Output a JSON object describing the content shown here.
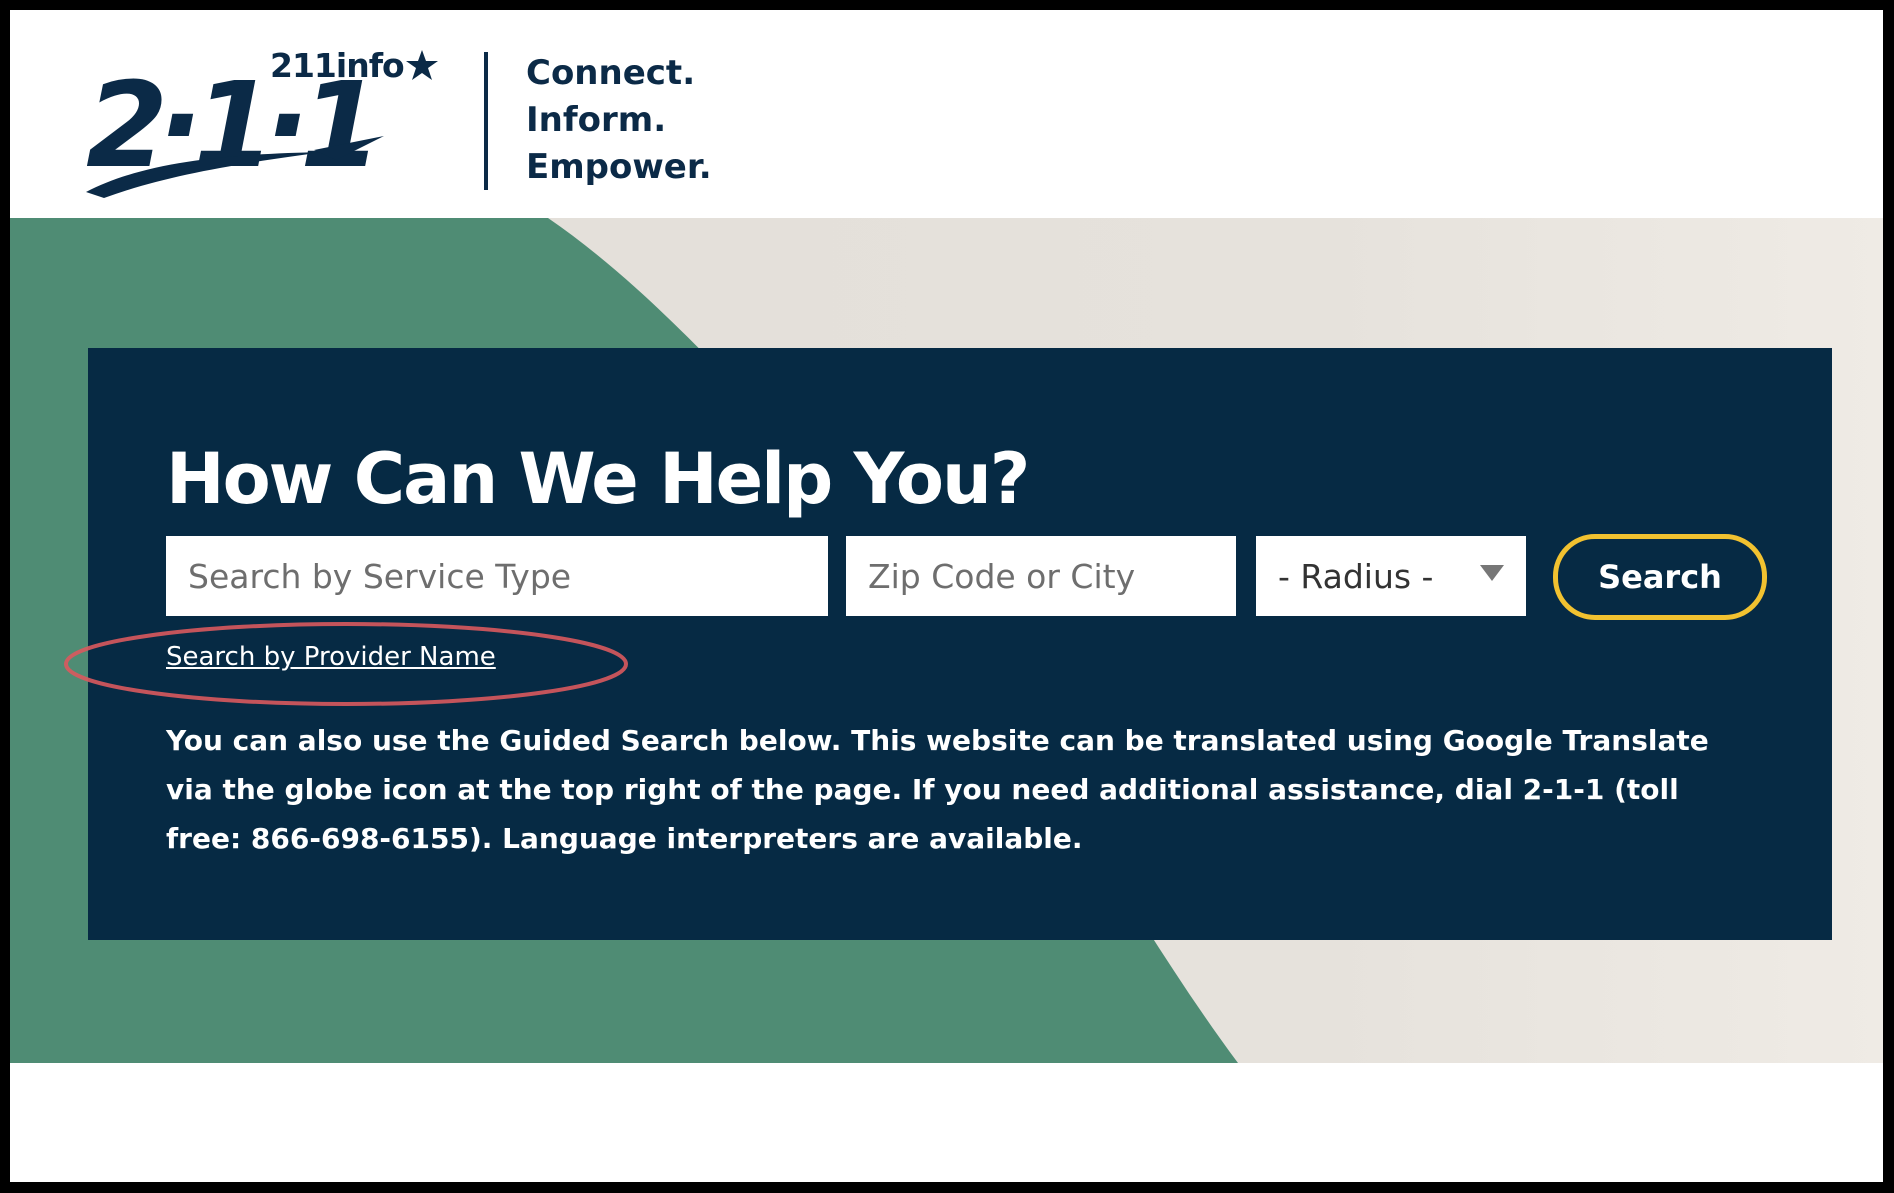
{
  "header": {
    "logo_small": "211info",
    "logo_main": "2·1·1",
    "tagline": [
      "Connect.",
      "Inform.",
      "Empower."
    ]
  },
  "hero": {
    "title": "How Can We Help You?",
    "service_placeholder": "Search by Service Type",
    "zip_placeholder": "Zip Code or City",
    "radius_label": "- Radius -",
    "search_label": "Search",
    "provider_link": "Search by Provider Name",
    "info_text": "You can also use the Guided Search below. This website can be translated using Google Translate via the globe icon at the top right of the page. If you need additional assistance, dial 2-1-1 (toll free: 866-698-6155). Language interpreters are available."
  },
  "colors": {
    "navy": "#062a44",
    "green": "#4f8c74",
    "accent_yellow": "#f2c230",
    "highlight_red": "#d9595e"
  }
}
